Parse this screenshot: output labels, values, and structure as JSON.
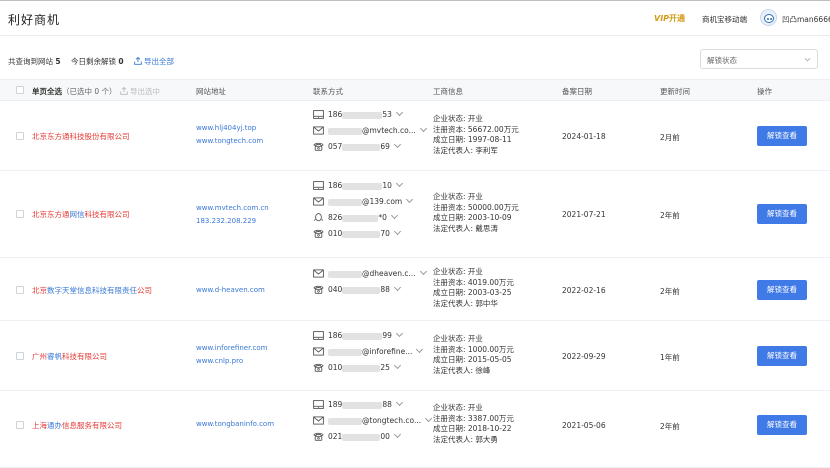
{
  "header": {
    "title": "利好商机",
    "vip_label": "VIP",
    "vip_sub": "开通",
    "mobile_label": "商机宝移动端",
    "user_name": "凹凸man6666"
  },
  "toolbar": {
    "summary_prefix": "共查询到网站",
    "summary_count": "5",
    "unlock_prefix": "今日剩余解锁",
    "unlock_count": "0",
    "export_all": "导出全部",
    "filter_select": "解锁状态"
  },
  "table": {
    "columns": {
      "select_all": "单页全选",
      "selected_info": "（已选中 0 个）",
      "export_selected": "导出选中",
      "website": "网站地址",
      "contact": "联系方式",
      "business": "工商信息",
      "record_date": "备案日期",
      "updated": "更新时间",
      "action": "操作"
    },
    "rows": [
      {
        "company_parts": [
          "北京东方通科技股份有限公司"
        ],
        "sites": [
          "www.hlj404yj.top",
          "www.tongtech.com"
        ],
        "contacts": [
          {
            "icon": "phone-icon",
            "pre": "186",
            "post": "53"
          },
          {
            "icon": "mail-icon",
            "pre": "",
            "post": "@mvtech.co..."
          },
          {
            "icon": "telephone-icon",
            "pre": "057",
            "post": "69"
          }
        ],
        "biz": {
          "status": "企业状态:  开业",
          "capital": "注册资本:  56672.00万元",
          "founded": "成立日期:  1997-08-11",
          "legal": "法定代表人:  李利军"
        },
        "record_date": "2024-01-18",
        "updated": "2月前",
        "action": "解锁查看"
      },
      {
        "company_parts": [
          "北京东方通",
          "网信",
          "科技有限公司"
        ],
        "sites": [
          "www.mvtech.com.cn",
          "183.232.208.229"
        ],
        "contacts": [
          {
            "icon": "phone-icon",
            "pre": "186",
            "post": "10"
          },
          {
            "icon": "mail-icon",
            "pre": "",
            "post": "@139.com"
          },
          {
            "icon": "qq-icon",
            "pre": "826",
            "post": "*0"
          },
          {
            "icon": "telephone-icon",
            "pre": "010",
            "post": "70"
          }
        ],
        "biz": {
          "status": "企业状态:  开业",
          "capital": "注册资本:  50000.00万元",
          "founded": "成立日期:  2003-10-09",
          "legal": "法定代表人:  戴思涛"
        },
        "record_date": "2021-07-21",
        "updated": "2年前",
        "action": "解锁查看"
      },
      {
        "company_parts": [
          "北京",
          "数字天堂信息科技有限责任",
          "公司"
        ],
        "sites": [
          "www.d-heaven.com"
        ],
        "contacts": [
          {
            "icon": "mail-icon",
            "pre": "",
            "post": "@dheaven.c..."
          },
          {
            "icon": "telephone-icon",
            "pre": "040",
            "post": "88"
          }
        ],
        "biz": {
          "status": "企业状态:  开业",
          "capital": "注册资本:  4019.00万元",
          "founded": "成立日期:  2003-03-25",
          "legal": "法定代表人:  郭中华"
        },
        "record_date": "2022-02-16",
        "updated": "2年前",
        "action": "解锁查看"
      },
      {
        "company_parts": [
          "广州",
          "睿帆",
          "科技有限公司"
        ],
        "sites": [
          "www.inforefiner.com",
          "www.cnlp.pro"
        ],
        "contacts": [
          {
            "icon": "phone-icon",
            "pre": "186",
            "post": "99"
          },
          {
            "icon": "mail-icon",
            "pre": "",
            "post": "@inforefine..."
          },
          {
            "icon": "telephone-icon",
            "pre": "010",
            "post": "25"
          }
        ],
        "biz": {
          "status": "企业状态:  开业",
          "capital": "注册资本:  1000.00万元",
          "founded": "成立日期:  2015-05-05",
          "legal": "法定代表人:  徐峰"
        },
        "record_date": "2022-09-29",
        "updated": "1年前",
        "action": "解锁查看"
      },
      {
        "company_parts": [
          "上海",
          "通办",
          "信息服务有限公司"
        ],
        "sites": [
          "www.tongbaninfo.com"
        ],
        "contacts": [
          {
            "icon": "phone-icon",
            "pre": "189",
            "post": "88"
          },
          {
            "icon": "mail-icon",
            "pre": "",
            "post": "@tongtech.co..."
          },
          {
            "icon": "telephone-icon",
            "pre": "021",
            "post": "00"
          }
        ],
        "biz": {
          "status": "企业状态:  开业",
          "capital": "注册资本:  3387.00万元",
          "founded": "成立日期:  2018-10-22",
          "legal": "法定代表人:  郭大勇"
        },
        "record_date": "2021-05-06",
        "updated": "2年前",
        "action": "解锁查看"
      }
    ]
  }
}
